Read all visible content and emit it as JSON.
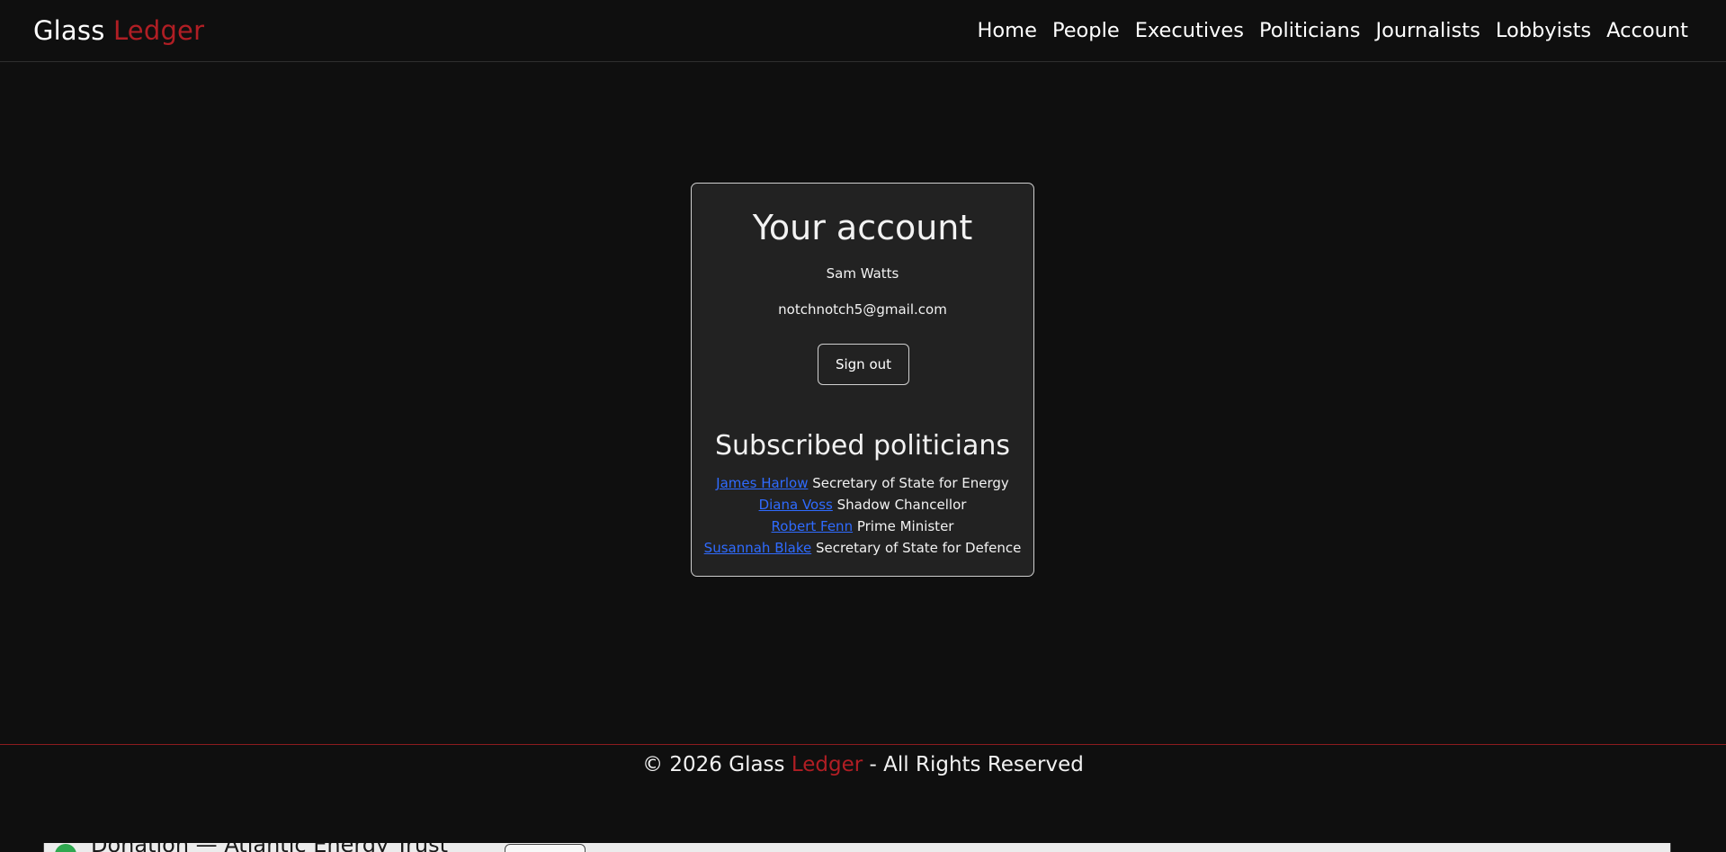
{
  "brand": {
    "first": "Glass",
    "second": "Ledger",
    "accent_color": "#b01e24"
  },
  "nav": {
    "items": [
      {
        "label": "Home"
      },
      {
        "label": "People"
      },
      {
        "label": "Executives"
      },
      {
        "label": "Politicians"
      },
      {
        "label": "Journalists"
      },
      {
        "label": "Lobbyists"
      },
      {
        "label": "Account"
      }
    ]
  },
  "account": {
    "title": "Your account",
    "name": "Sam Watts",
    "email": "notchnotch5@gmail.com",
    "signout_label": "Sign out"
  },
  "subscriptions": {
    "title": "Subscribed politicians",
    "items": [
      {
        "name": "James Harlow",
        "role": "Secretary of State for Energy"
      },
      {
        "name": "Diana Voss",
        "role": "Shadow Chancellor"
      },
      {
        "name": "Robert Fenn",
        "role": "Prime Minister"
      },
      {
        "name": "Susannah Blake",
        "role": "Secretary of State for Defence"
      }
    ]
  },
  "footer": {
    "prefix": "© 2026 Glass",
    "brand_accent": "Ledger",
    "suffix": "- All Rights Reserved"
  },
  "peek": {
    "text": "Donation — Atlantic Energy Trust",
    "status_icon": "status-dot-icon",
    "status_color": "#2fa84f"
  }
}
